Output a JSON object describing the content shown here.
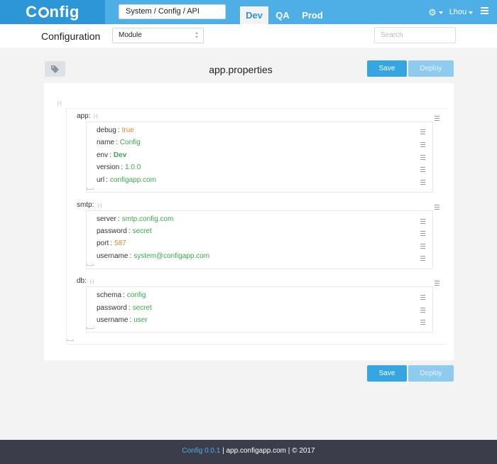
{
  "app": {
    "logo": "Config"
  },
  "header": {
    "breadcrumb": "System / Config / API",
    "env_tabs": [
      {
        "label": "Dev"
      },
      {
        "label": "QA"
      },
      {
        "label": "Prod"
      }
    ],
    "active_env": "Dev",
    "user_name": "Lhou"
  },
  "subheader": {
    "title": "Configuration",
    "module_value": "Module",
    "search_placeholder": "Search"
  },
  "toolbar": {
    "file_name": "app.properties",
    "save_label": "Save",
    "deploy_label": "Deploy"
  },
  "editor": {
    "sections": [
      {
        "key": "app",
        "entries": [
          {
            "key": "debug",
            "value": "true",
            "type": "bool"
          },
          {
            "key": "name",
            "value": "Config",
            "type": "string"
          },
          {
            "key": "env",
            "value": "Dev",
            "type": "bold"
          },
          {
            "key": "version",
            "value": "1.0.0",
            "type": "string"
          },
          {
            "key": "url",
            "value": "configapp.com",
            "type": "string"
          }
        ]
      },
      {
        "key": "smtp",
        "entries": [
          {
            "key": "server",
            "value": "smtp.config.com",
            "type": "string"
          },
          {
            "key": "password",
            "value": "secret",
            "type": "string"
          },
          {
            "key": "port",
            "value": "587",
            "type": "number"
          },
          {
            "key": "username",
            "value": "system@configapp.com",
            "type": "string"
          }
        ]
      },
      {
        "key": "db",
        "entries": [
          {
            "key": "schema",
            "value": "config",
            "type": "string"
          },
          {
            "key": "password",
            "value": "secret",
            "type": "string"
          },
          {
            "key": "username",
            "value": "user",
            "type": "string"
          }
        ]
      }
    ]
  },
  "footer": {
    "version": "Config 0.0.1",
    "site": "app.configapp.com",
    "copyright": "© 2017",
    "separator": "|"
  },
  "colors": {
    "topbar": "#4eaee6",
    "logo_bg": "#2d96d6",
    "save_button": "#35a6e2",
    "deploy_button": "#8fcbef",
    "string_value": "#3aa84e",
    "number_value": "#e8822d",
    "footer_bg": "#3b3e4a"
  }
}
